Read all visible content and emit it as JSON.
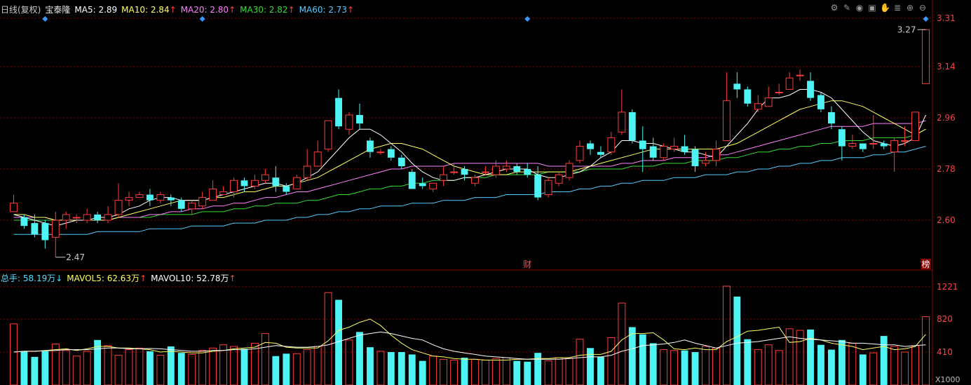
{
  "header": {
    "period": "日线(复权)",
    "stock_name": "宝泰隆",
    "ma": [
      {
        "label": "MA5:",
        "value": "2.89",
        "arrow": "",
        "color": "#ffffff"
      },
      {
        "label": "MA10:",
        "value": "2.84",
        "arrow": "↑",
        "color": "#ffff66"
      },
      {
        "label": "MA20:",
        "value": "2.80",
        "arrow": "↑",
        "color": "#ff80ff"
      },
      {
        "label": "MA30:",
        "value": "2.82",
        "arrow": "↑",
        "color": "#33dd33"
      },
      {
        "label": "MA60:",
        "value": "2.73",
        "arrow": "↑",
        "color": "#55ccff"
      }
    ]
  },
  "vol_header": [
    {
      "label": "总手:",
      "value": "58.19万",
      "arrow": "↓",
      "color": "#55ddff"
    },
    {
      "label": "MAVOL5:",
      "value": "62.63万",
      "arrow": "↑",
      "color": "#ffff66"
    },
    {
      "label": "MAVOL10:",
      "value": "52.78万",
      "arrow": "↑",
      "color": "#ffffff"
    }
  ],
  "toolbar_icons": [
    "settings-icon",
    "brush-icon",
    "eye-icon",
    "lock-icon",
    "hand-icon",
    "stack-icon",
    "zoom-in-icon",
    "zoom-out-icon"
  ],
  "colors": {
    "up": "#ff3b3b",
    "down": "#4ef4f4",
    "grid": "#8b0000",
    "axis_text": "#ff4040"
  },
  "markers": {
    "cai": "财",
    "bang": "榜",
    "low_label": "2.47",
    "high_label": "3.27"
  },
  "chart_data": [
    {
      "type": "candlestick",
      "y_ticks": [
        "3.31",
        "3.14",
        "2.96",
        "2.78",
        "2.60"
      ],
      "ylim": [
        2.43,
        3.32
      ],
      "ohlc": [
        [
          2.63,
          2.66,
          2.63,
          2.69
        ],
        [
          2.61,
          2.58,
          2.57,
          2.62
        ],
        [
          2.59,
          2.55,
          2.54,
          2.62
        ],
        [
          2.59,
          2.53,
          2.5,
          2.6
        ],
        [
          2.54,
          2.6,
          2.47,
          2.63
        ],
        [
          2.6,
          2.62,
          2.57,
          2.63
        ],
        [
          2.61,
          2.61,
          2.59,
          2.62
        ],
        [
          2.6,
          2.62,
          2.59,
          2.64
        ],
        [
          2.62,
          2.6,
          2.59,
          2.63
        ],
        [
          2.6,
          2.62,
          2.59,
          2.65
        ],
        [
          2.62,
          2.67,
          2.61,
          2.73
        ],
        [
          2.67,
          2.68,
          2.65,
          2.7
        ],
        [
          2.68,
          2.69,
          2.68,
          2.7
        ],
        [
          2.69,
          2.67,
          2.65,
          2.71
        ],
        [
          2.67,
          2.69,
          2.66,
          2.7
        ],
        [
          2.68,
          2.67,
          2.65,
          2.69
        ],
        [
          2.67,
          2.64,
          2.63,
          2.68
        ],
        [
          2.64,
          2.66,
          2.62,
          2.67
        ],
        [
          2.65,
          2.68,
          2.64,
          2.7
        ],
        [
          2.67,
          2.71,
          2.67,
          2.74
        ],
        [
          2.69,
          2.7,
          2.69,
          2.72
        ],
        [
          2.7,
          2.74,
          2.68,
          2.75
        ],
        [
          2.74,
          2.72,
          2.7,
          2.75
        ],
        [
          2.72,
          2.74,
          2.71,
          2.76
        ],
        [
          2.74,
          2.76,
          2.73,
          2.78
        ],
        [
          2.75,
          2.72,
          2.7,
          2.79
        ],
        [
          2.72,
          2.7,
          2.69,
          2.73
        ],
        [
          2.71,
          2.75,
          2.71,
          2.76
        ],
        [
          2.75,
          2.79,
          2.74,
          2.85
        ],
        [
          2.79,
          2.84,
          2.79,
          2.88
        ],
        [
          2.85,
          2.95,
          2.84,
          2.95
        ],
        [
          3.03,
          2.93,
          2.92,
          3.06
        ],
        [
          2.92,
          2.97,
          2.9,
          2.98
        ],
        [
          2.97,
          2.94,
          2.92,
          3.01
        ],
        [
          2.88,
          2.84,
          2.82,
          2.89
        ],
        [
          2.84,
          2.84,
          2.83,
          2.85
        ],
        [
          2.85,
          2.82,
          2.81,
          2.86
        ],
        [
          2.82,
          2.79,
          2.78,
          2.83
        ],
        [
          2.77,
          2.71,
          2.71,
          2.78
        ],
        [
          2.73,
          2.72,
          2.71,
          2.75
        ],
        [
          2.71,
          2.73,
          2.7,
          2.73
        ],
        [
          2.74,
          2.76,
          2.72,
          2.79
        ],
        [
          2.77,
          2.77,
          2.76,
          2.8
        ],
        [
          2.78,
          2.76,
          2.74,
          2.79
        ],
        [
          2.73,
          2.75,
          2.72,
          2.76
        ],
        [
          2.77,
          2.77,
          2.76,
          2.79
        ],
        [
          2.76,
          2.79,
          2.75,
          2.81
        ],
        [
          2.78,
          2.79,
          2.77,
          2.81
        ],
        [
          2.79,
          2.77,
          2.76,
          2.8
        ],
        [
          2.78,
          2.76,
          2.75,
          2.8
        ],
        [
          2.76,
          2.68,
          2.67,
          2.79
        ],
        [
          2.69,
          2.74,
          2.68,
          2.75
        ],
        [
          2.73,
          2.76,
          2.72,
          2.77
        ],
        [
          2.75,
          2.8,
          2.74,
          2.81
        ],
        [
          2.81,
          2.86,
          2.8,
          2.88
        ],
        [
          2.87,
          2.85,
          2.83,
          2.88
        ],
        [
          2.84,
          2.83,
          2.82,
          2.86
        ],
        [
          2.84,
          2.89,
          2.83,
          2.91
        ],
        [
          2.91,
          2.98,
          2.9,
          3.06
        ],
        [
          2.98,
          2.88,
          2.87,
          2.99
        ],
        [
          2.88,
          2.85,
          2.77,
          2.93
        ],
        [
          2.86,
          2.82,
          2.81,
          2.89
        ],
        [
          2.82,
          2.86,
          2.81,
          2.87
        ],
        [
          2.85,
          2.86,
          2.84,
          2.89
        ],
        [
          2.86,
          2.84,
          2.83,
          2.9
        ],
        [
          2.85,
          2.79,
          2.77,
          2.86
        ],
        [
          2.8,
          2.81,
          2.79,
          2.84
        ],
        [
          2.81,
          2.85,
          2.79,
          2.88
        ],
        [
          2.88,
          3.02,
          2.88,
          3.12
        ],
        [
          3.08,
          3.06,
          3.03,
          3.12
        ],
        [
          3.06,
          3.01,
          3.0,
          3.07
        ],
        [
          2.99,
          3.01,
          2.98,
          3.04
        ],
        [
          3.0,
          3.03,
          3.0,
          3.07
        ],
        [
          3.05,
          3.05,
          3.04,
          3.08
        ],
        [
          3.06,
          3.1,
          3.06,
          3.12
        ],
        [
          3.11,
          3.11,
          3.09,
          3.13
        ],
        [
          3.09,
          3.03,
          3.02,
          3.12
        ],
        [
          3.04,
          2.99,
          2.98,
          3.05
        ],
        [
          2.98,
          2.94,
          2.92,
          3.0
        ],
        [
          2.92,
          2.86,
          2.81,
          2.93
        ],
        [
          2.86,
          2.87,
          2.85,
          2.9
        ],
        [
          2.87,
          2.85,
          2.84,
          2.87
        ],
        [
          2.87,
          2.87,
          2.85,
          2.97
        ],
        [
          2.87,
          2.86,
          2.85,
          2.88
        ],
        [
          2.84,
          2.88,
          2.77,
          2.89
        ],
        [
          2.88,
          2.88,
          2.86,
          2.93
        ],
        [
          2.88,
          2.98,
          2.88,
          2.98
        ],
        [
          3.08,
          3.27,
          3.08,
          3.27
        ]
      ],
      "ma5": [
        2.62,
        2.61,
        2.6,
        2.59,
        2.58,
        2.59,
        2.6,
        2.6,
        2.61,
        2.61,
        2.62,
        2.64,
        2.65,
        2.67,
        2.68,
        2.68,
        2.67,
        2.67,
        2.67,
        2.68,
        2.69,
        2.7,
        2.71,
        2.72,
        2.73,
        2.73,
        2.72,
        2.73,
        2.75,
        2.77,
        2.81,
        2.85,
        2.89,
        2.92,
        2.92,
        2.9,
        2.87,
        2.84,
        2.8,
        2.77,
        2.75,
        2.74,
        2.74,
        2.75,
        2.75,
        2.76,
        2.77,
        2.78,
        2.78,
        2.78,
        2.76,
        2.75,
        2.75,
        2.76,
        2.77,
        2.79,
        2.82,
        2.84,
        2.88,
        2.88,
        2.87,
        2.87,
        2.86,
        2.85,
        2.84,
        2.84,
        2.83,
        2.82,
        2.86,
        2.9,
        2.94,
        2.99,
        3.03,
        3.03,
        3.04,
        3.06,
        3.06,
        3.05,
        3.03,
        2.99,
        2.95,
        2.91,
        2.88,
        2.87,
        2.86,
        2.87,
        2.89,
        2.97
      ],
      "ma10": [
        2.62,
        2.62,
        2.61,
        2.61,
        2.6,
        2.6,
        2.6,
        2.6,
        2.6,
        2.6,
        2.61,
        2.62,
        2.63,
        2.64,
        2.65,
        2.66,
        2.67,
        2.67,
        2.67,
        2.68,
        2.68,
        2.69,
        2.7,
        2.7,
        2.71,
        2.72,
        2.72,
        2.73,
        2.74,
        2.75,
        2.77,
        2.79,
        2.81,
        2.83,
        2.85,
        2.86,
        2.87,
        2.87,
        2.86,
        2.85,
        2.83,
        2.81,
        2.79,
        2.78,
        2.77,
        2.76,
        2.76,
        2.76,
        2.77,
        2.77,
        2.77,
        2.77,
        2.77,
        2.77,
        2.78,
        2.79,
        2.8,
        2.81,
        2.82,
        2.83,
        2.84,
        2.85,
        2.85,
        2.85,
        2.85,
        2.85,
        2.85,
        2.85,
        2.86,
        2.87,
        2.89,
        2.91,
        2.93,
        2.95,
        2.97,
        2.99,
        3.0,
        3.01,
        3.02,
        3.02,
        3.01,
        3.0,
        2.98,
        2.96,
        2.94,
        2.92,
        2.9,
        2.92
      ],
      "ma20": [
        2.61,
        2.61,
        2.61,
        2.61,
        2.6,
        2.6,
        2.6,
        2.6,
        2.6,
        2.6,
        2.61,
        2.61,
        2.61,
        2.62,
        2.62,
        2.63,
        2.63,
        2.64,
        2.64,
        2.65,
        2.65,
        2.66,
        2.66,
        2.67,
        2.68,
        2.68,
        2.69,
        2.7,
        2.7,
        2.71,
        2.72,
        2.73,
        2.74,
        2.75,
        2.76,
        2.77,
        2.78,
        2.78,
        2.79,
        2.79,
        2.79,
        2.79,
        2.8,
        2.8,
        2.8,
        2.8,
        2.8,
        2.8,
        2.8,
        2.8,
        2.8,
        2.79,
        2.79,
        2.79,
        2.79,
        2.79,
        2.79,
        2.79,
        2.8,
        2.8,
        2.81,
        2.81,
        2.81,
        2.82,
        2.82,
        2.82,
        2.82,
        2.83,
        2.83,
        2.84,
        2.85,
        2.86,
        2.87,
        2.88,
        2.89,
        2.9,
        2.91,
        2.92,
        2.93,
        2.93,
        2.93,
        2.93,
        2.94,
        2.94,
        2.94,
        2.94,
        2.94,
        2.95
      ],
      "ma30": [
        2.6,
        2.6,
        2.6,
        2.6,
        2.6,
        2.6,
        2.6,
        2.6,
        2.6,
        2.6,
        2.61,
        2.61,
        2.61,
        2.61,
        2.62,
        2.62,
        2.62,
        2.62,
        2.63,
        2.63,
        2.63,
        2.64,
        2.64,
        2.65,
        2.65,
        2.66,
        2.66,
        2.66,
        2.67,
        2.67,
        2.68,
        2.69,
        2.69,
        2.7,
        2.71,
        2.71,
        2.72,
        2.72,
        2.73,
        2.73,
        2.74,
        2.74,
        2.74,
        2.75,
        2.75,
        2.75,
        2.76,
        2.76,
        2.76,
        2.76,
        2.76,
        2.77,
        2.77,
        2.77,
        2.77,
        2.78,
        2.78,
        2.78,
        2.78,
        2.79,
        2.79,
        2.79,
        2.8,
        2.8,
        2.8,
        2.81,
        2.81,
        2.81,
        2.82,
        2.82,
        2.83,
        2.84,
        2.84,
        2.85,
        2.85,
        2.86,
        2.86,
        2.87,
        2.87,
        2.88,
        2.88,
        2.88,
        2.89,
        2.89,
        2.89,
        2.89,
        2.9,
        2.92
      ],
      "ma60": [
        2.55,
        2.55,
        2.55,
        2.55,
        2.55,
        2.55,
        2.55,
        2.55,
        2.56,
        2.56,
        2.56,
        2.56,
        2.56,
        2.57,
        2.57,
        2.57,
        2.57,
        2.58,
        2.58,
        2.58,
        2.58,
        2.59,
        2.59,
        2.59,
        2.6,
        2.6,
        2.6,
        2.61,
        2.61,
        2.62,
        2.62,
        2.63,
        2.63,
        2.64,
        2.64,
        2.65,
        2.65,
        2.65,
        2.66,
        2.66,
        2.66,
        2.67,
        2.67,
        2.67,
        2.68,
        2.68,
        2.68,
        2.69,
        2.69,
        2.69,
        2.69,
        2.7,
        2.7,
        2.7,
        2.71,
        2.71,
        2.72,
        2.72,
        2.73,
        2.73,
        2.74,
        2.74,
        2.74,
        2.75,
        2.75,
        2.75,
        2.76,
        2.76,
        2.76,
        2.77,
        2.77,
        2.78,
        2.78,
        2.79,
        2.79,
        2.8,
        2.8,
        2.81,
        2.81,
        2.82,
        2.82,
        2.82,
        2.83,
        2.83,
        2.84,
        2.84,
        2.85,
        2.86
      ]
    },
    {
      "type": "bar",
      "y_ticks": [
        "1221",
        "820",
        "410"
      ],
      "unit": "X1000",
      "ylim": [
        0,
        1300
      ],
      "volume": [
        760,
        420,
        350,
        420,
        510,
        430,
        360,
        420,
        560,
        490,
        370,
        440,
        460,
        420,
        370,
        480,
        400,
        380,
        430,
        460,
        500,
        480,
        450,
        520,
        640,
        360,
        390,
        390,
        440,
        480,
        1150,
        1060,
        560,
        660,
        470,
        420,
        410,
        410,
        380,
        300,
        360,
        320,
        310,
        340,
        320,
        310,
        330,
        340,
        300,
        290,
        400,
        300,
        340,
        330,
        570,
        460,
        350,
        590,
        1020,
        720,
        630,
        520,
        440,
        430,
        430,
        410,
        480,
        460,
        1230,
        1100,
        570,
        440,
        500,
        430,
        700,
        680,
        690,
        500,
        440,
        560,
        520,
        380,
        400,
        610,
        480,
        410,
        490,
        850
      ],
      "mavol5": [
        410,
        420,
        420,
        430,
        440,
        450,
        430,
        450,
        480,
        480,
        460,
        460,
        450,
        440,
        410,
        420,
        410,
        400,
        400,
        420,
        430,
        450,
        460,
        470,
        530,
        520,
        470,
        460,
        460,
        460,
        550,
        680,
        720,
        780,
        820,
        740,
        620,
        520,
        440,
        400,
        360,
        350,
        330,
        320,
        320,
        310,
        310,
        310,
        320,
        320,
        330,
        330,
        340,
        340,
        370,
        380,
        380,
        420,
        560,
        640,
        640,
        650,
        560,
        450,
        440,
        460,
        440,
        440,
        540,
        600,
        670,
        680,
        700,
        720,
        530,
        540,
        580,
        560,
        520,
        500,
        480,
        440,
        460,
        480,
        440,
        450,
        480,
        630
      ],
      "mavol10": [
        410,
        420,
        420,
        425,
        430,
        440,
        440,
        440,
        450,
        460,
        460,
        450,
        450,
        455,
        450,
        440,
        430,
        420,
        420,
        430,
        430,
        440,
        440,
        450,
        470,
        490,
        480,
        470,
        470,
        480,
        500,
        540,
        580,
        620,
        640,
        660,
        640,
        610,
        580,
        560,
        500,
        450,
        420,
        400,
        380,
        360,
        350,
        340,
        330,
        320,
        320,
        320,
        320,
        330,
        340,
        350,
        350,
        370,
        420,
        450,
        490,
        500,
        510,
        530,
        560,
        520,
        490,
        460,
        490,
        520,
        530,
        540,
        560,
        580,
        600,
        580,
        570,
        560,
        550,
        540,
        520,
        520,
        510,
        500,
        500,
        480,
        490,
        500
      ]
    }
  ]
}
